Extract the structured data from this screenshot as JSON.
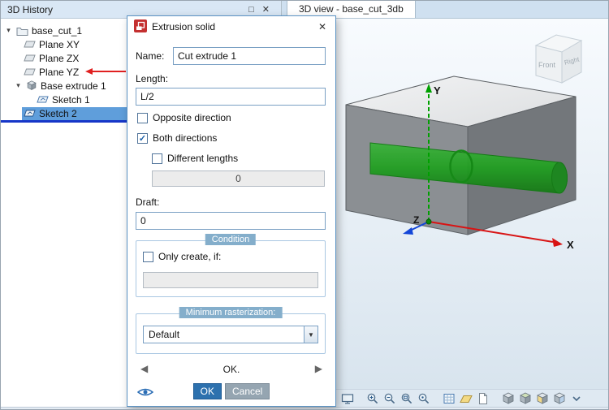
{
  "glyphs": {
    "check": "✓",
    "close": "✕",
    "float_window": "□",
    "dropdown_arrow": "▼",
    "nav_left": "◀",
    "nav_right": "▶",
    "expander": "▾"
  },
  "left_panel": {
    "title": "3D History",
    "tree": [
      {
        "label": "base_cut_1",
        "icon": "model-folder",
        "expanded": true
      },
      {
        "label": "Plane XY",
        "icon": "workplane"
      },
      {
        "label": "Plane ZX",
        "icon": "workplane"
      },
      {
        "label": "Plane YZ",
        "icon": "workplane",
        "marker": "red-arrow"
      },
      {
        "label": "Base extrude 1",
        "icon": "extrude",
        "expanded": true
      },
      {
        "label": "Sketch 1",
        "icon": "sketch"
      },
      {
        "label": "Sketch 2",
        "icon": "sketch",
        "selected": true
      }
    ]
  },
  "tabs": {
    "view_tab": "3D view - base_cut_3db"
  },
  "dialog": {
    "title": "Extrusion solid",
    "name_label": "Name:",
    "name_value": "Cut extrude 1",
    "length_label": "Length:",
    "length_value": "L/2",
    "opposite_direction_label": "Opposite direction",
    "both_directions_label": "Both directions",
    "different_lengths_label": "Different lengths",
    "different_lengths_value": "0",
    "draft_label": "Draft:",
    "draft_value": "0",
    "condition_title": "Condition",
    "only_create_label": "Only create, if:",
    "condition_value": "",
    "raster_title": "Minimum rasterization:",
    "raster_value": "Default",
    "nav_status": "OK.",
    "ok_label": "OK",
    "cancel_label": "Cancel",
    "checkbox_states": {
      "opposite_direction": false,
      "both_directions": true,
      "different_lengths": false,
      "only_create_if": false
    }
  },
  "viewport": {
    "axes": {
      "x": "X",
      "y": "Y",
      "z": "Z"
    },
    "view_cube": {
      "front": "Front",
      "right": "Right"
    }
  },
  "toolbar": {
    "icons": [
      "fit-screen",
      "zoom-in",
      "zoom-out",
      "zoom-window",
      "zoom-all",
      "grid",
      "workplane",
      "sheet",
      "view-iso-1",
      "view-iso-2",
      "view-iso-3",
      "view-iso-4",
      "more"
    ]
  },
  "colors": {
    "selection": "#5f9edb",
    "insert_line": "#1636c8",
    "marker_arrow": "#e02020",
    "ok_button": "#2d71ae",
    "axis_x": "#d81414",
    "axis_y": "#00a000",
    "axis_z": "#1346d8",
    "cylinder": "#1fa01f",
    "box_front": "#8b8f93",
    "box_side": "#73777b",
    "box_top": "#ececec"
  }
}
